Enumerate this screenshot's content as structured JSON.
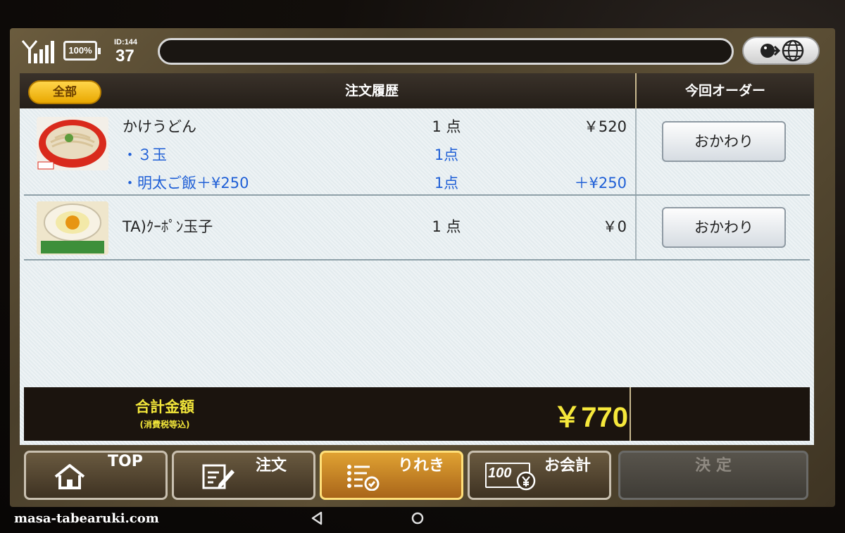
{
  "status": {
    "battery": "100%",
    "id_label": "ID:144",
    "id_number": "37"
  },
  "header": {
    "filter_tab": "全部",
    "title": "注文履歴",
    "right_title": "今回オーダー"
  },
  "orders": [
    {
      "name": "かけうどん",
      "qty": "1 点",
      "price": "￥520",
      "refill_label": "おかわり",
      "options": [
        {
          "name": "・３玉",
          "qty": "1点",
          "price": ""
        },
        {
          "name": "・明太ご飯＋¥250",
          "qty": "1点",
          "price": "＋¥250"
        }
      ]
    },
    {
      "name": "TA)ｸｰﾎﾟﾝ玉子",
      "qty": "1 点",
      "price": "￥0",
      "refill_label": "おかわり"
    }
  ],
  "total": {
    "label": "合計金額",
    "note": "(消費税等込)",
    "amount": "￥770"
  },
  "nav": {
    "top": "TOP",
    "order": "注文",
    "history": "りれき",
    "checkout": "お会計",
    "checkout_icon_text": "100",
    "confirm": "決 定"
  },
  "footer": {
    "credit": "masa-tabearuki.com"
  },
  "colors": {
    "accent": "#f6e83b",
    "option_text": "#1f5fd6",
    "active_nav": "#e0a232"
  },
  "icons": [
    "signal-icon",
    "battery-icon",
    "globe-icon",
    "home-icon",
    "edit-icon",
    "history-list-icon",
    "money-icon",
    "back-icon",
    "home-circle-icon"
  ]
}
